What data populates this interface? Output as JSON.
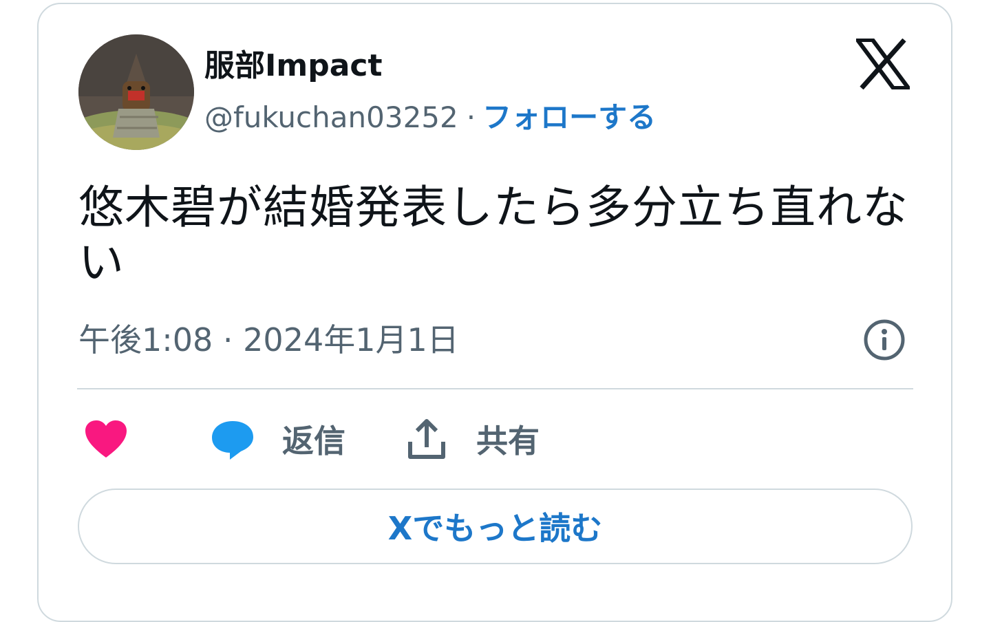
{
  "author": {
    "display_name": "服部Impact",
    "handle": "@fukuchan03252",
    "separator": "·",
    "follow_label": "フォローする",
    "avatar_icon": "avatar-photo"
  },
  "tweet": {
    "text": "悠木碧が結婚発表したら多分立ち直れない",
    "timestamp": "午後1:08 · 2024年1月1日"
  },
  "actions": {
    "like_icon": "heart-icon",
    "reply_label": "返信",
    "share_label": "共有"
  },
  "read_more_label": "Xでもっと読む",
  "colors": {
    "accent": "#1d77c9",
    "like": "#f91880",
    "reply": "#1d9bf0",
    "muted": "#536471",
    "text": "#0f1419",
    "border": "#cfd9de"
  }
}
